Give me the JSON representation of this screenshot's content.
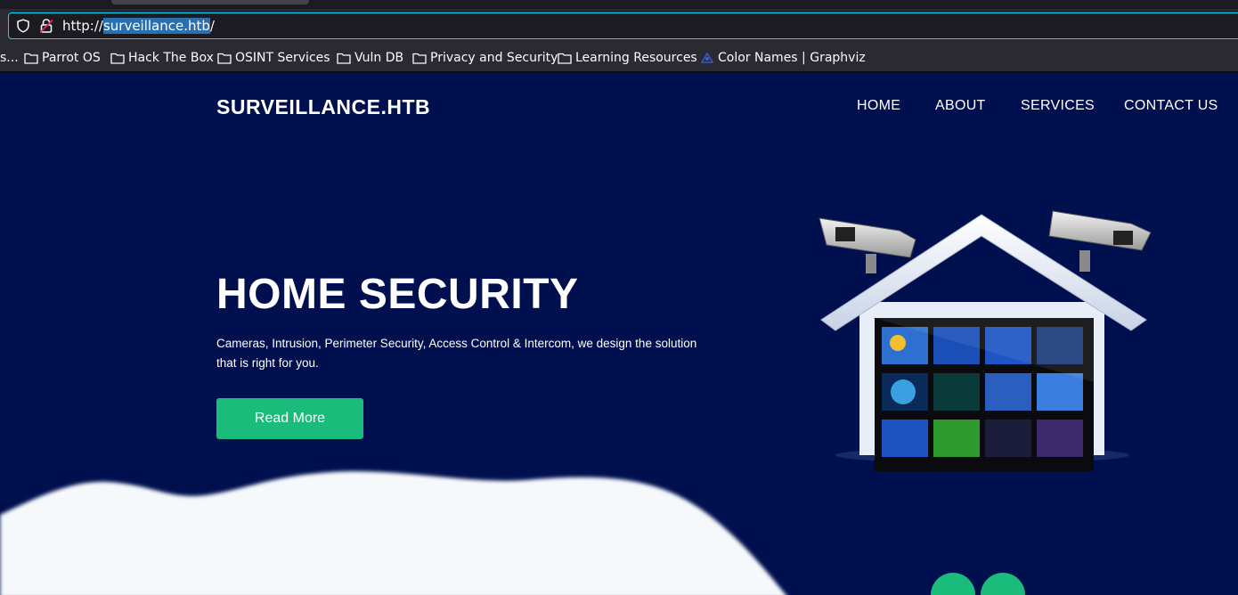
{
  "browser": {
    "url_prefix": "http://",
    "url_host": "surveillance.htb",
    "url_suffix": "/",
    "bookmarks": [
      {
        "label": "s...",
        "icon": "none"
      },
      {
        "label": "Parrot OS",
        "icon": "folder-icon"
      },
      {
        "label": "Hack The Box",
        "icon": "folder-icon"
      },
      {
        "label": "OSINT Services",
        "icon": "folder-icon"
      },
      {
        "label": "Vuln DB",
        "icon": "folder-icon"
      },
      {
        "label": "Privacy and Security",
        "icon": "folder-icon"
      },
      {
        "label": "Learning Resources",
        "icon": "folder-icon"
      },
      {
        "label": "Color Names | Graphviz",
        "icon": "graphviz-icon"
      }
    ],
    "accent_color": "#00ddff"
  },
  "site": {
    "brand": "SURVEILLANCE.HTB",
    "nav": [
      "HOME",
      "ABOUT",
      "SERVICES",
      "CONTACT US"
    ],
    "hero": {
      "title": "HOME SECURITY",
      "subtitle": "Cameras, Intrusion, Perimeter Security, Access Control & Intercom, we design the solution that is right for you.",
      "button": "Read More"
    },
    "carousel": {
      "prev": "←",
      "next": "→"
    },
    "colors": {
      "background": "#00104f",
      "accent": "#1bbc7b",
      "wave": "#f6f9fc"
    }
  }
}
